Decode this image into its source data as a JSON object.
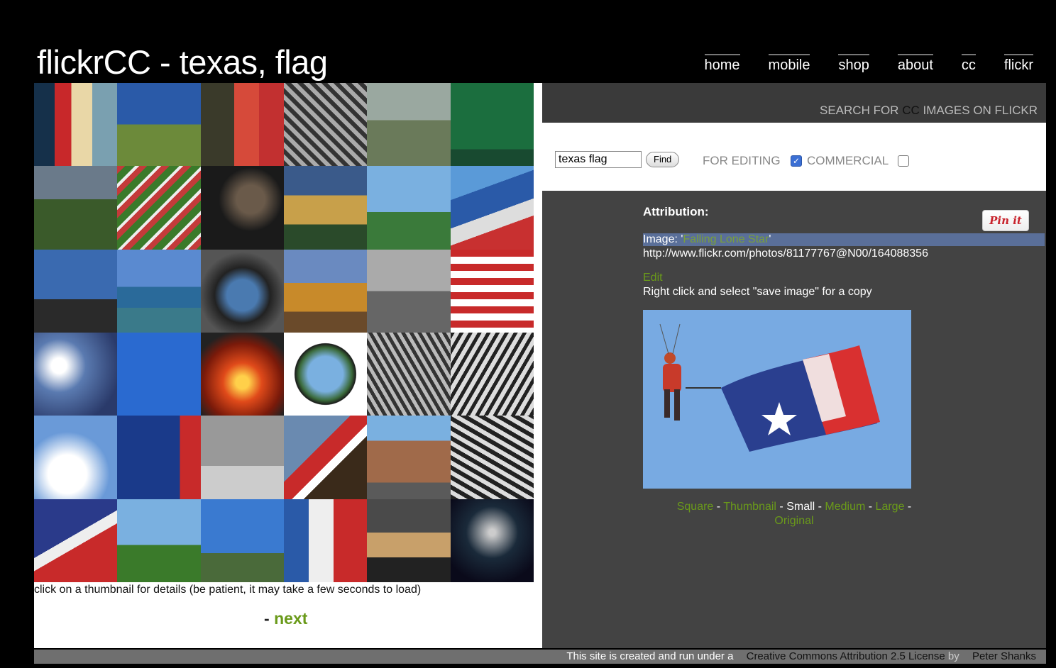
{
  "header": {
    "title": "flickrCC - texas, flag",
    "nav": [
      {
        "label": "home"
      },
      {
        "label": "mobile"
      },
      {
        "label": "shop"
      },
      {
        "label": "about"
      },
      {
        "label": "cc"
      },
      {
        "label": "flickr"
      }
    ]
  },
  "gallery": {
    "hint": "click on a thumbnail for details (be patient, it may take a few seconds to load)",
    "pager_prefix": "- ",
    "next_label": "next"
  },
  "search": {
    "heading_prefix": "SEARCH FOR ",
    "heading_cc": "CC",
    "heading_suffix": " IMAGES ON FLICKR",
    "query": "texas flag",
    "find_label": "Find",
    "for_editing_label": "FOR EDITING",
    "commercial_label": "COMMERCIAL"
  },
  "attribution": {
    "title": "Attribution:",
    "pin_label": "Pin it",
    "image_prefix": "Image: '",
    "image_title": "Falling Lone Star",
    "image_suffix": "'",
    "url": "http://www.flickr.com/photos/81177767@N00/164088356",
    "edit_label": "Edit",
    "save_note": "Right click and select \"save image\" for a copy",
    "sizes": {
      "square": "Square",
      "thumbnail": "Thumbnail",
      "small": "Small",
      "medium": "Medium",
      "large": "Large",
      "original": "Original"
    }
  },
  "footer": {
    "prefix": "This site is created and run under a ",
    "license": "Creative Commons Attribution 2.5 License",
    "by": " by ",
    "author": "Peter Shanks"
  },
  "colors": {
    "link_green": "#6a9a1a",
    "panel_dark": "#434343",
    "highlight_blue": "#5a6f99"
  }
}
